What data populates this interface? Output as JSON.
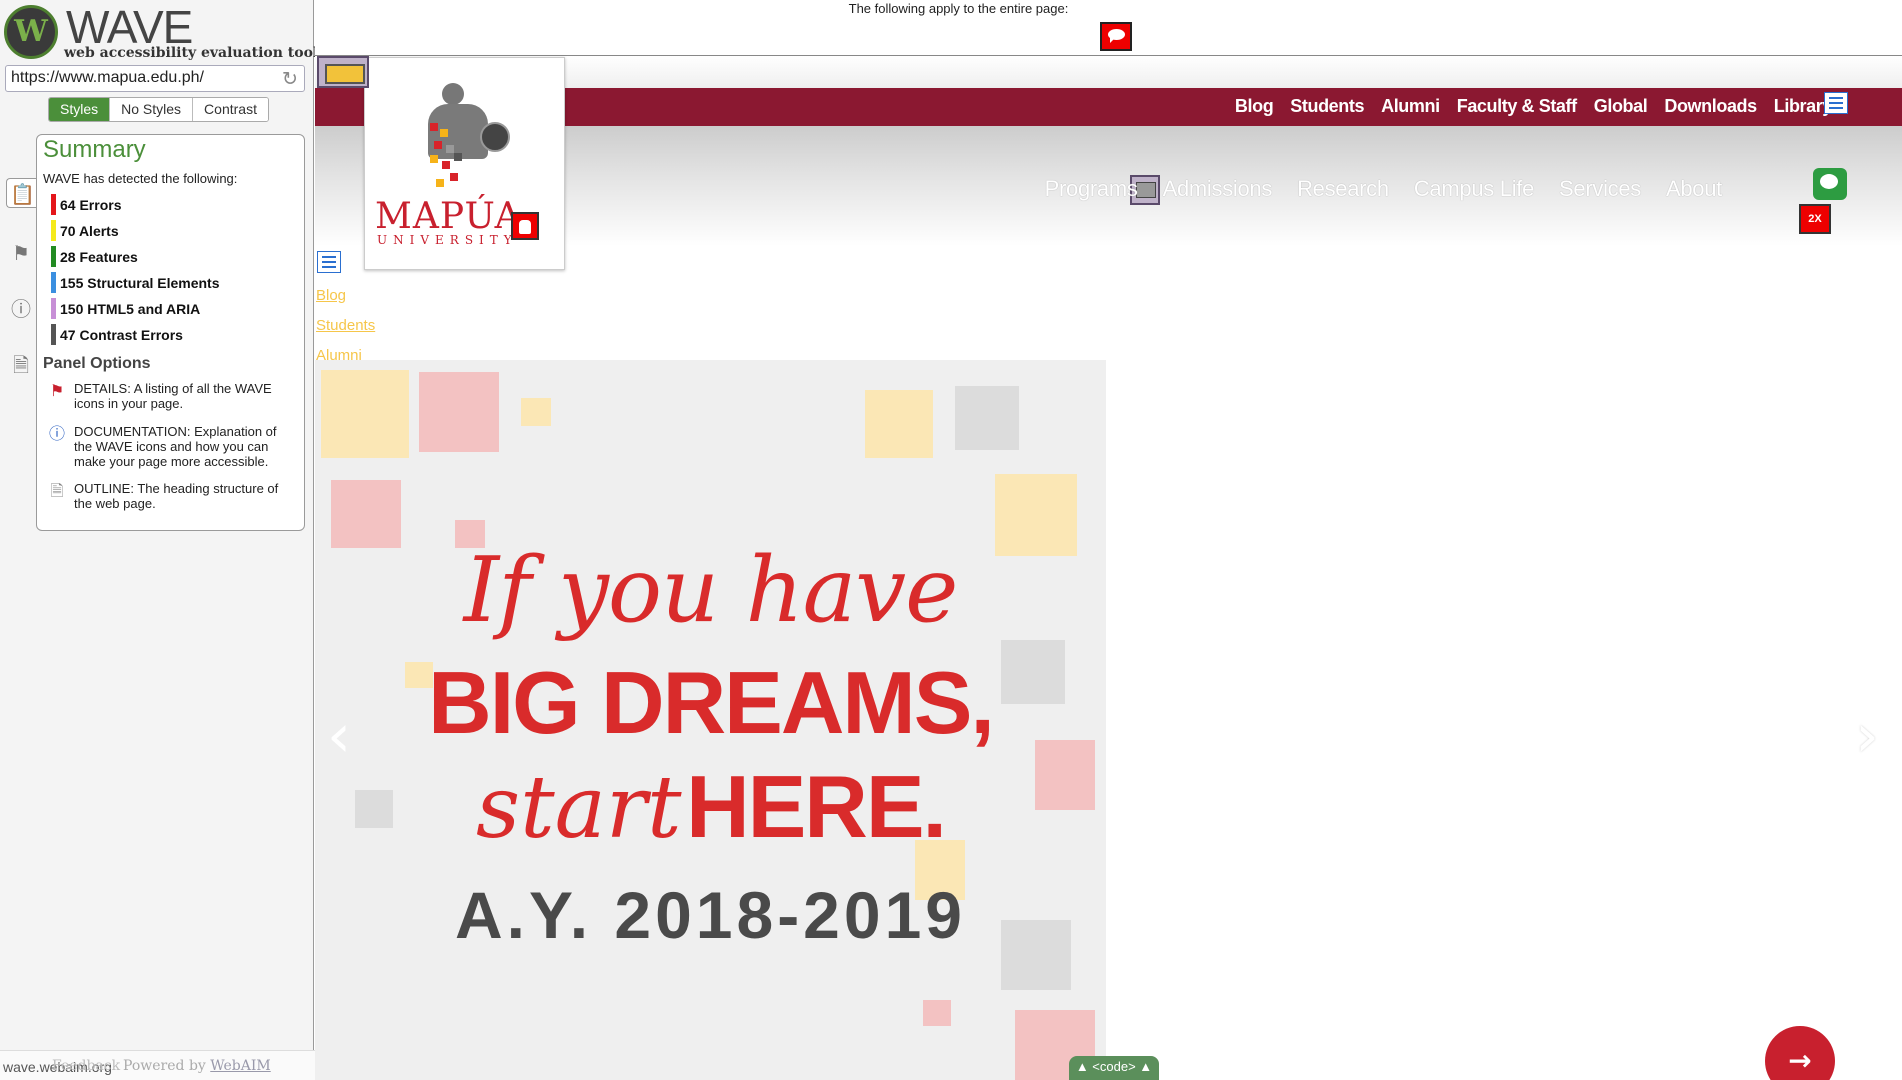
{
  "wave": {
    "title": "WAVE",
    "subtitle": "web accessibility evaluation tool",
    "url": "https://www.mapua.edu.ph/",
    "tabs": [
      "Styles",
      "No Styles",
      "Contrast"
    ],
    "active_tab": "Styles",
    "summary": {
      "title": "Summary",
      "intro": "WAVE has detected the following:",
      "items": [
        {
          "label": "64 Errors",
          "color": "#e4161b"
        },
        {
          "label": "70 Alerts",
          "color": "#f5ea1b"
        },
        {
          "label": "28 Features",
          "color": "#228b22"
        },
        {
          "label": "155 Structural Elements",
          "color": "#3b8fe0"
        },
        {
          "label": "150 HTML5 and ARIA",
          "color": "#c78fd6"
        },
        {
          "label": "47 Contrast Errors",
          "color": "#555555"
        }
      ],
      "panel_options_title": "Panel Options",
      "options": [
        {
          "icon": "flag-icon",
          "text": "DETAILS: A listing of all the WAVE icons in your page."
        },
        {
          "icon": "info-icon",
          "text": "DOCUMENTATION: Explanation of the WAVE icons and how you can make your page more accessible."
        },
        {
          "icon": "document-icon",
          "text": "OUTLINE: The heading structure of the web page."
        }
      ]
    },
    "footer": {
      "site_link": "wave.webaim.org",
      "feedback": "Feedback",
      "powered": "Powered by",
      "webaim": "WebAIM"
    }
  },
  "page": {
    "entire_page_notice": "The following apply to the entire page:",
    "top_links": [
      "Blog",
      "Students",
      "Alumni",
      "Faculty & Staff",
      "Global",
      "Downloads",
      "Library"
    ],
    "main_nav": [
      "Programs",
      "Admissions",
      "Research",
      "Campus Life",
      "Services",
      "About"
    ],
    "logo": {
      "name": "MAPÚA",
      "sub": "UNIVERSITY"
    },
    "unstyled_links": [
      "Blog",
      "Students",
      "Alumni"
    ],
    "contrast_icon_label": "2X",
    "slide": {
      "line1": "If you have",
      "line2": "BIG DREAMS,",
      "line3_italic": "start",
      "line3_bold": "HERE.",
      "line4": "A.Y. 2018-2019"
    },
    "code_tab": "▲ <code> ▲",
    "next_arrow": "→",
    "prev_arrow": "‹",
    "next_slide_arrow": "›",
    "accent_color": "#8b1831",
    "wave_green": "#4b8f3a"
  }
}
